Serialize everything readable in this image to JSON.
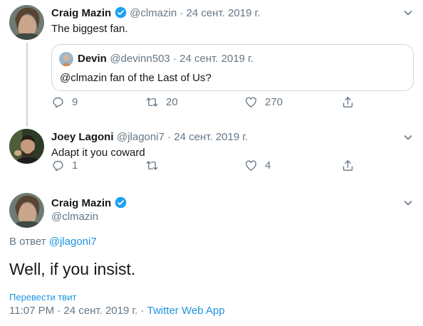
{
  "tweet1": {
    "name": "Craig Mazin",
    "handle": "@clmazin",
    "sep": " · ",
    "date": "24 сент. 2019 г.",
    "text": "The biggest fan.",
    "quote": {
      "name": "Devin",
      "handle": "@devinn503",
      "sep": " · ",
      "date": "24 сент. 2019 г.",
      "text": "@clmazin fan of the Last of Us?"
    },
    "replies": "9",
    "retweets": "20",
    "likes": "270"
  },
  "tweet2": {
    "name": "Joey Lagoni",
    "handle": "@jlagoni7",
    "sep": " · ",
    "date": "24 сент. 2019 г.",
    "text": "Adapt it you coward",
    "replies": "1",
    "retweets": "",
    "likes": "4"
  },
  "main": {
    "name": "Craig Mazin",
    "handle": "@clmazin",
    "reply_prefix": "В ответ ",
    "reply_to": "@jlagoni7",
    "text": "Well, if you insist.",
    "translate": "Перевести твит",
    "time": "11:07 PM · 24 сент. 2019 г. · ",
    "source": "Twitter Web App"
  },
  "colors": {
    "link": "#1b95e0",
    "verified": "#1da1f2",
    "muted": "#657786",
    "border": "#ccd6dd"
  }
}
